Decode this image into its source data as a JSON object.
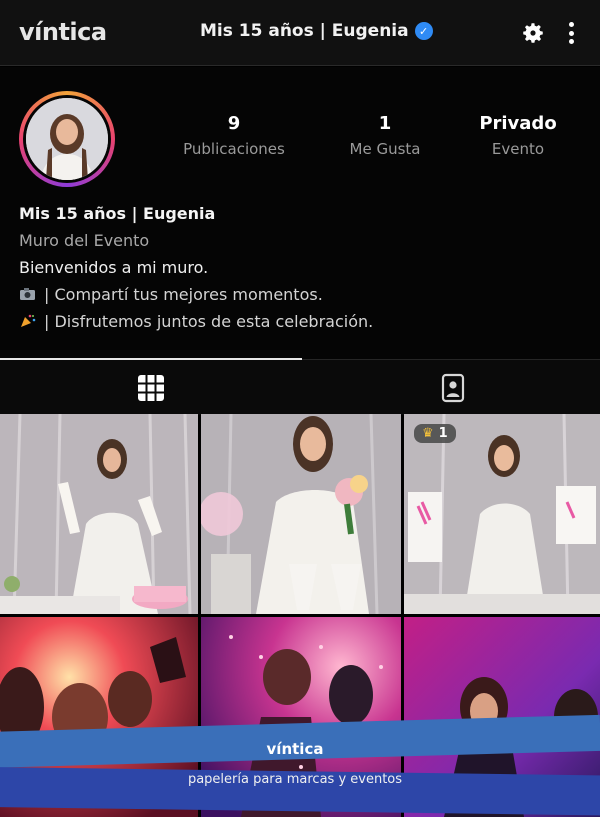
{
  "header": {
    "brand": "víntica",
    "title": "Mis 15 años | Eugenia",
    "verified_icon": "verified-check-icon",
    "settings_icon": "gear-icon",
    "more_icon": "more-vertical-icon"
  },
  "profile": {
    "stats": [
      {
        "value": "9",
        "label": "Publicaciones"
      },
      {
        "value": "1",
        "label": "Me Gusta"
      },
      {
        "value": "Privado",
        "label": "Evento"
      }
    ],
    "name": "Mis 15 años | Eugenia",
    "category": "Muro del Evento",
    "bio_line1": "Bienvenidos a mi muro.",
    "bio_line2": "| Compartí tus mejores momentos.",
    "bio_line3": "| Disfrutemos juntos de esta celebración.",
    "bio_icons": [
      "camera-emoji-icon",
      "party-popper-emoji-icon"
    ]
  },
  "tabs": {
    "active": "grid",
    "items": [
      {
        "id": "grid",
        "icon": "grid-icon"
      },
      {
        "id": "tagged",
        "icon": "tagged-person-icon"
      }
    ]
  },
  "posts": {
    "badge_count": "1",
    "badge_icon": "crown-icon"
  },
  "banner": {
    "title": "víntica",
    "subtitle": "papelería para marcas y eventos"
  },
  "colors": {
    "verified": "#2f8bf5",
    "banner_top": "#3a6fb9",
    "banner_bottom": "#2d46a8"
  }
}
